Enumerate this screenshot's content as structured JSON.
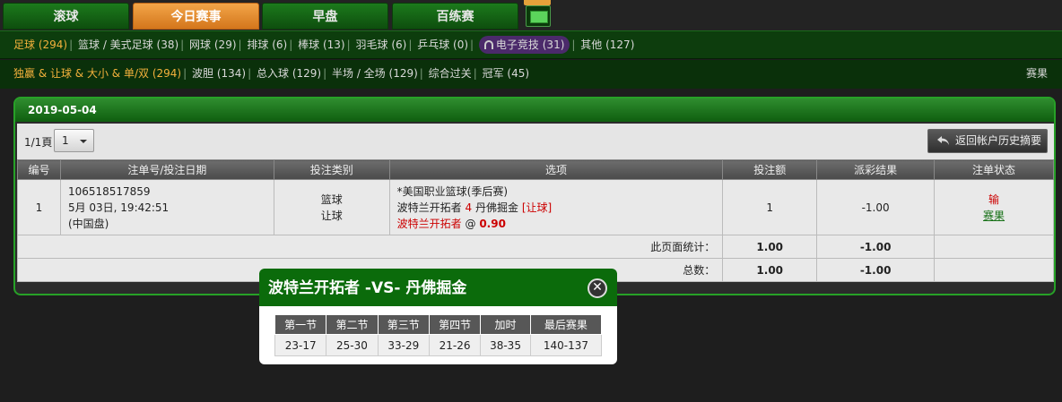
{
  "top_tabs": [
    "滚球",
    "今日赛事",
    "早盘",
    "百练赛"
  ],
  "sport_nav": [
    {
      "label": "足球",
      "count": "(294)"
    },
    {
      "label": "篮球 / 美式足球",
      "count": "(38)"
    },
    {
      "label": "网球",
      "count": "(29)"
    },
    {
      "label": "排球",
      "count": "(6)"
    },
    {
      "label": "棒球",
      "count": "(13)"
    },
    {
      "label": "羽毛球",
      "count": "(6)"
    },
    {
      "label": "乒乓球",
      "count": "(0)"
    },
    {
      "label": "电子竞技",
      "count": "(31)"
    },
    {
      "label": "其他",
      "count": "(127)"
    }
  ],
  "bet_nav": [
    {
      "label": "独赢 & 让球 & 大小 & 单/双",
      "count": "(294)"
    },
    {
      "label": "波胆",
      "count": "(134)"
    },
    {
      "label": "总入球",
      "count": "(129)"
    },
    {
      "label": "半场 / 全场",
      "count": "(129)"
    },
    {
      "label": "综合过关",
      "count": ""
    },
    {
      "label": "冠军",
      "count": "(45)"
    }
  ],
  "bet_nav_right": "赛果",
  "panel": {
    "date": "2019-05-04",
    "page_label": "1/1頁",
    "page_select": "1",
    "history_button": "返回帐户历史摘要",
    "columns": [
      "编号",
      "注单号/投注日期",
      "投注类别",
      "选项",
      "投注额",
      "派彩结果",
      "注单状态"
    ],
    "row": {
      "no": "1",
      "ticket": "106518517859",
      "date": "5月 03日, 19:42:51",
      "market": "(中国盘)",
      "type1": "篮球",
      "type2": "让球",
      "league": "*美国职业篮球(季后赛)",
      "home": "波特兰开拓者",
      "handicap": "4",
      "away": "丹佛掘金",
      "bet_kind": "[让球]",
      "pick": "波特兰开拓者",
      "at": "@",
      "odds": "0.90",
      "stake": "1",
      "result": "-1.00",
      "status": "输",
      "status_link": "赛果"
    },
    "page_stats_label": "此页面统计：",
    "page_stats_stake": "1.00",
    "page_stats_result": "-1.00",
    "total_label": "总数：",
    "total_stake": "1.00",
    "total_result": "-1.00"
  },
  "modal": {
    "title": "波特兰开拓者 -VS- 丹佛掘金",
    "close_glyph": "✕",
    "headers": [
      "第一节",
      "第二节",
      "第三节",
      "第四节",
      "加时",
      "最后赛果"
    ],
    "scores": [
      "23-17",
      "25-30",
      "33-29",
      "21-26",
      "38-35",
      "140-137"
    ]
  },
  "colors": {
    "accent_green": "#0b6b0b",
    "active_tab": "#e68a2e",
    "loss_red": "#cc0000"
  }
}
